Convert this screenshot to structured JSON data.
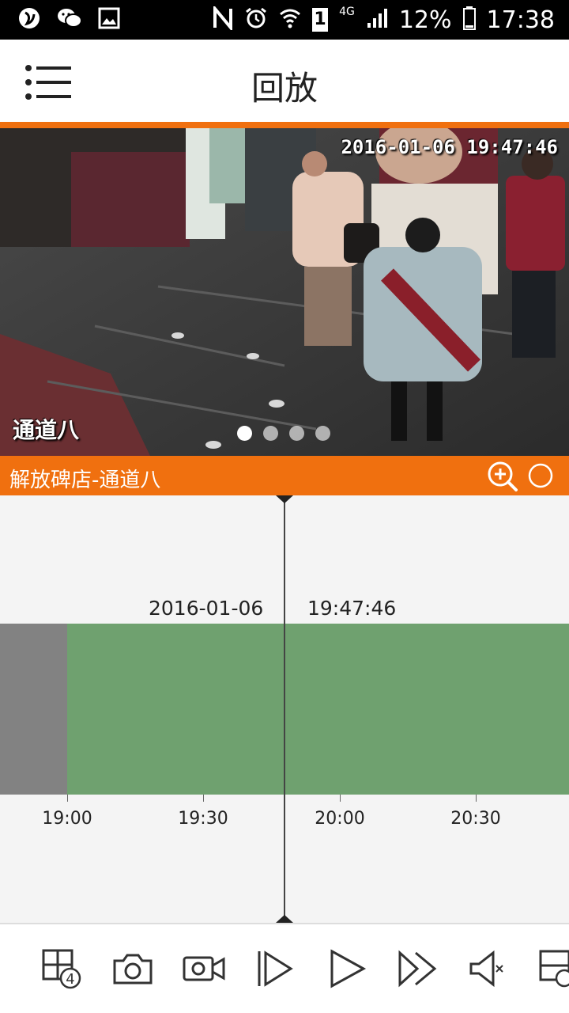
{
  "status_bar": {
    "battery": "12%",
    "time": "17:38",
    "network": "4G",
    "sim": "1",
    "icons": [
      "app-icon",
      "wechat-icon",
      "image-icon",
      "nfc-icon",
      "alarm-icon",
      "wifi-icon",
      "signal-icon",
      "battery-icon"
    ]
  },
  "header": {
    "title": "回放",
    "menu_icon": "menu-list-icon"
  },
  "video": {
    "timestamp_overlay": "2016-01-06  19:47:46",
    "channel_overlay": "通道八",
    "page_count": 4,
    "active_page": 1
  },
  "channel_bar": {
    "name": "解放碑店-通道八",
    "zoom_icon": "zoom-in-icon",
    "circle_icon": "circle-icon"
  },
  "timeline": {
    "date": "2016-01-06",
    "time": "19:47:46",
    "ticks": [
      "19:00",
      "19:30",
      "20:00",
      "20:30"
    ],
    "colors": {
      "no_record": "#828282",
      "recorded": "#6fa16f",
      "accent": "#f0700f"
    }
  },
  "toolbar": {
    "buttons": [
      "split-4-icon",
      "snapshot-camera-icon",
      "record-video-icon",
      "slow-play-icon",
      "play-icon",
      "fast-forward-icon",
      "mute-icon",
      "more-icon"
    ],
    "split_count": "4"
  }
}
